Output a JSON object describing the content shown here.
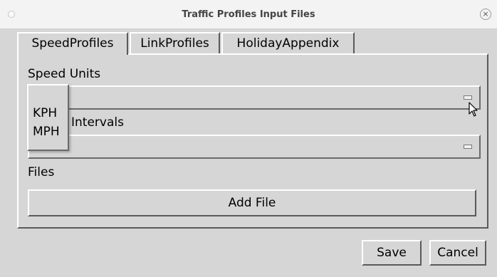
{
  "window": {
    "title": "Traffic Profiles Input Files"
  },
  "tabs": [
    {
      "label": "SpeedProfiles",
      "active": true
    },
    {
      "label": "LinkProfiles",
      "active": false
    },
    {
      "label": "HolidayAppendix",
      "active": false
    }
  ],
  "speed_profiles": {
    "speed_units_label": "Speed Units",
    "speed_units_value": "",
    "speed_units_options": [
      "KPH",
      "MPH"
    ],
    "intervals_label": "Intervals",
    "intervals_value": "",
    "files_label": "Files",
    "add_file_label": "Add File"
  },
  "footer": {
    "save_label": "Save",
    "cancel_label": "Cancel"
  },
  "icons": {
    "close": "close-icon",
    "combo": "combo-handle-icon",
    "cursor": "mouse-pointer-icon"
  }
}
